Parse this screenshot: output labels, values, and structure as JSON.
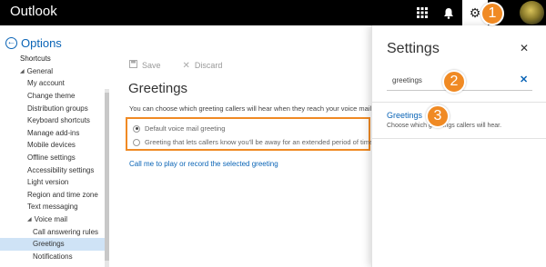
{
  "app": {
    "title": "Outlook"
  },
  "topbar": {
    "icons": {
      "apps": "app-launcher-icon",
      "notifications": "bell-icon",
      "settings": "gear-icon",
      "profile": "avatar"
    }
  },
  "callouts": [
    "1",
    "2",
    "3"
  ],
  "colors": {
    "accent": "#0a64b6",
    "highlight": "#f08a24",
    "topbar": "#000000",
    "selected_nav": "#cfe3f6"
  },
  "sidebar": {
    "heading": "Options",
    "items": [
      {
        "label": "Shortcuts",
        "level": 0
      },
      {
        "label": "General",
        "level": 1,
        "expanded": true
      },
      {
        "label": "My account",
        "level": 2
      },
      {
        "label": "Change theme",
        "level": 2
      },
      {
        "label": "Distribution groups",
        "level": 2
      },
      {
        "label": "Keyboard shortcuts",
        "level": 2
      },
      {
        "label": "Manage add-ins",
        "level": 2
      },
      {
        "label": "Mobile devices",
        "level": 2
      },
      {
        "label": "Offline settings",
        "level": 2
      },
      {
        "label": "Accessibility settings",
        "level": 2
      },
      {
        "label": "Light version",
        "level": 2
      },
      {
        "label": "Region and time zone",
        "level": 2
      },
      {
        "label": "Text messaging",
        "level": 2
      },
      {
        "label": "Voice mail",
        "level": 2,
        "expanded": true
      },
      {
        "label": "Call answering rules",
        "level": 3
      },
      {
        "label": "Greetings",
        "level": 3,
        "selected": true
      },
      {
        "label": "Notifications",
        "level": 3
      }
    ]
  },
  "main": {
    "save_label": "Save",
    "discard_label": "Discard",
    "title": "Greetings",
    "description": "You can choose which greeting callers will hear when they reach your voice mail.",
    "options": [
      {
        "label": "Default voice mail greeting",
        "checked": true
      },
      {
        "label": "Greeting that lets callers know you'll be away for an extended period of time",
        "checked": false
      }
    ],
    "call_link": "Call me to play or record the selected greeting"
  },
  "settings_panel": {
    "title": "Settings",
    "close_icon": "close-icon",
    "search": {
      "value": "greetings",
      "placeholder": ""
    },
    "result": {
      "title": "Greetings",
      "description": "Choose which greetings callers will hear."
    }
  }
}
